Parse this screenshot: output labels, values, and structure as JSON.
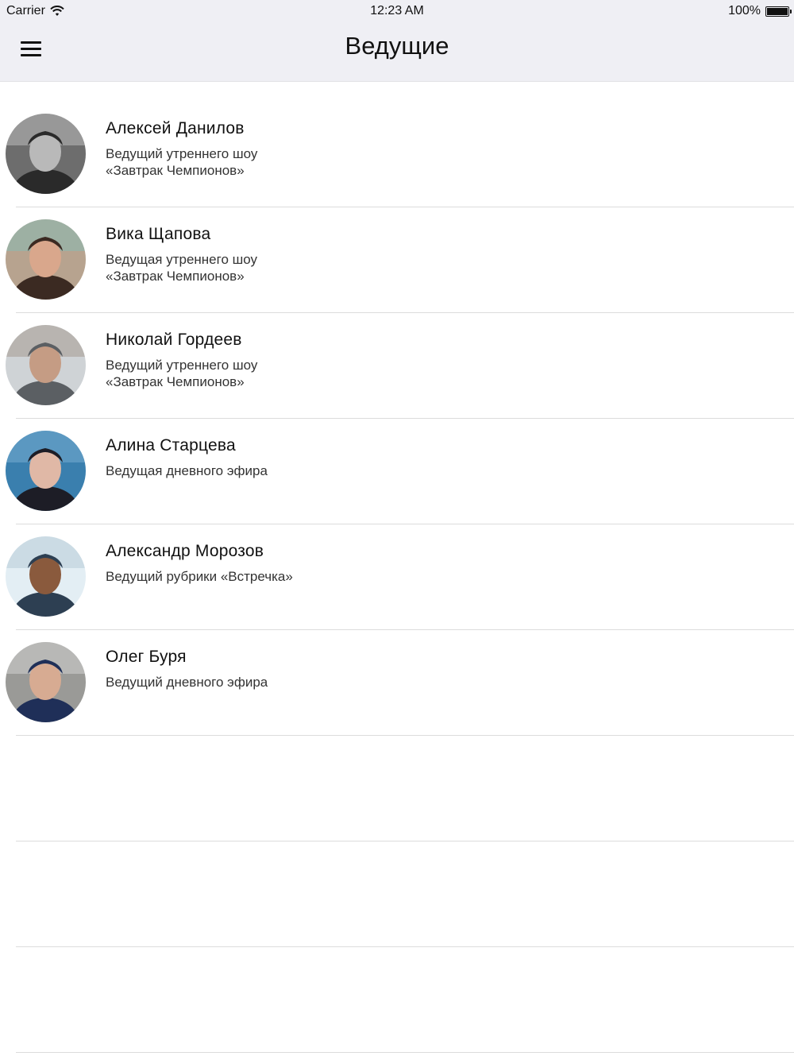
{
  "status_bar": {
    "carrier": "Carrier",
    "time": "12:23 AM",
    "battery": "100%"
  },
  "nav": {
    "title": "Ведущие",
    "menu_icon": "hamburger-menu-icon"
  },
  "hosts": [
    {
      "name": "Алексей Данилов",
      "role": "Ведущий утреннего шоу\n«Завтрак Чемпионов»",
      "avatar": {
        "bg": "#6d6d6d",
        "fg": "#2a2a2a",
        "skin": "#b9b9b9",
        "accent": "#e9e9e9"
      }
    },
    {
      "name": "Вика Щапова",
      "role": "Ведущая утреннего шоу\n«Завтрак Чемпионов»",
      "avatar": {
        "bg": "#b7a38f",
        "fg": "#3b2a22",
        "skin": "#d9a78c",
        "accent": "#6ec8c9"
      }
    },
    {
      "name": "Николай Гордеев",
      "role": "Ведущий утреннего шоу\n«Завтрак Чемпионов»",
      "avatar": {
        "bg": "#cfd3d6",
        "fg": "#5b5f63",
        "skin": "#c59c84",
        "accent": "#8b7a6a"
      }
    },
    {
      "name": "Алина Старцева",
      "role": "Ведущая дневного эфира",
      "avatar": {
        "bg": "#3a7fae",
        "fg": "#1d1d26",
        "skin": "#e0b8a6",
        "accent": "#9bc9e6"
      }
    },
    {
      "name": "Александр Морозов",
      "role": "Ведущий рубрики «Встречка»",
      "avatar": {
        "bg": "#e3eef4",
        "fg": "#2d3f52",
        "skin": "#8a5a3d",
        "accent": "#9fb6c7"
      }
    },
    {
      "name": "Олег Буря",
      "role": "Ведущий дневного эфира",
      "avatar": {
        "bg": "#9a9a97",
        "fg": "#1f2f58",
        "skin": "#d7ab92",
        "accent": "#f2f2f2"
      }
    }
  ]
}
